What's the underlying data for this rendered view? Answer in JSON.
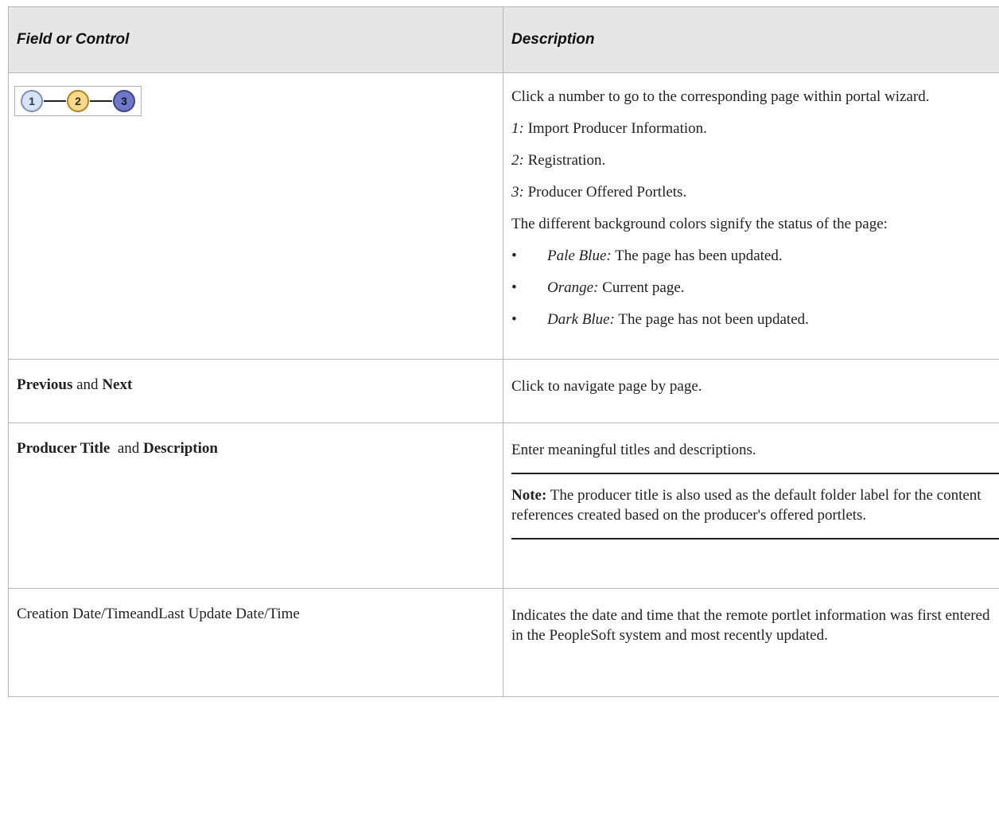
{
  "headers": {
    "field": "Field or Control",
    "description": "Description"
  },
  "wizard": {
    "steps": [
      {
        "label": "1",
        "fill": "#d6e3f5",
        "ring": "#7f8fb5",
        "text": "#2a3555"
      },
      {
        "label": "2",
        "fill": "#f6d98a",
        "ring": "#b08420",
        "text": "#3a2a00"
      },
      {
        "label": "3",
        "fill": "#6e78c4",
        "ring": "#3b428a",
        "text": "#0c1030"
      }
    ]
  },
  "row1": {
    "intro": "Click a number to go to the corresponding page within portal wizard.",
    "items": [
      {
        "key": "1:",
        "text": " Import Producer Information."
      },
      {
        "key": "2:",
        "text": " Registration."
      },
      {
        "key": "3:",
        "text": " Producer Offered Portlets."
      }
    ],
    "status_intro": "The different background colors signify the status of the page:",
    "bullets": [
      {
        "symbol": "•",
        "key": "Pale Blue:",
        "text": " The page has been updated."
      },
      {
        "symbol": "•",
        "key": "Orange:",
        "text": " Current page."
      },
      {
        "symbol": "•",
        "key": "Dark Blue:",
        "text": " The page has not been updated."
      }
    ]
  },
  "row2": {
    "field_a": "Previous",
    "joiner": " and ",
    "field_b": "Next",
    "description": "Click to navigate page by page."
  },
  "row3": {
    "field_a": "Producer Title",
    "joiner": "  and ",
    "field_b": "Description",
    "description": "Enter meaningful titles and descriptions.",
    "note_label": "Note:",
    "note_text": " The producer title is also used as the default folder label for the content references created based on the producer's offered portlets."
  },
  "row4": {
    "field": "Creation Date/TimeandLast Update Date/Time",
    "description": "Indicates the date and time that the remote portlet information was first entered in the PeopleSoft system and most recently updated."
  }
}
